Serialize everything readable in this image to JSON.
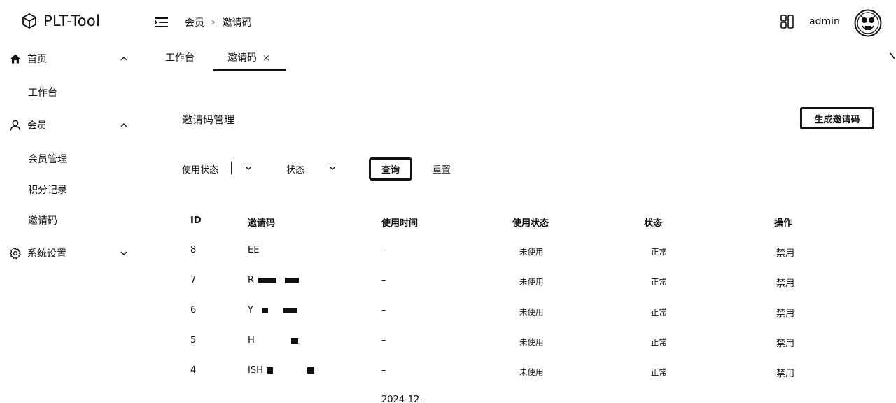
{
  "app": {
    "title": "PLT-Tool"
  },
  "sidebar": {
    "groups": [
      {
        "label": "首页",
        "icon": "home-icon",
        "expanded": true,
        "items": [
          {
            "label": "工作台"
          }
        ]
      },
      {
        "label": "会员",
        "icon": "user-icon",
        "expanded": true,
        "items": [
          {
            "label": "会员管理"
          },
          {
            "label": "积分记录"
          },
          {
            "label": "邀请码"
          }
        ]
      },
      {
        "label": "系统设置",
        "icon": "gear-icon",
        "expanded": false,
        "items": []
      }
    ]
  },
  "header": {
    "breadcrumb": [
      "会员",
      "邀请码"
    ],
    "user": "admin"
  },
  "tabs": [
    {
      "label": "工作台",
      "active": false
    },
    {
      "label": "邀请码",
      "active": true,
      "close": "×"
    }
  ],
  "page": {
    "title": "邀请码管理",
    "generate_button": "生成邀请码"
  },
  "filters": {
    "use_status_label": "使用状态",
    "status_label": "状态",
    "query_button": "查询",
    "reset_button": "重置"
  },
  "table": {
    "columns": [
      "ID",
      "邀请码",
      "使用时间",
      "使用状态",
      "状态",
      "操作"
    ],
    "rows": [
      {
        "id": "8",
        "code": "EE",
        "used_time": "–",
        "use_status": "未使用",
        "status": "正常",
        "action": "禁用"
      },
      {
        "id": "7",
        "code": "R",
        "used_time": "–",
        "use_status": "未使用",
        "status": "正常",
        "action": "禁用"
      },
      {
        "id": "6",
        "code": "Y",
        "used_time": "–",
        "use_status": "未使用",
        "status": "正常",
        "action": "禁用"
      },
      {
        "id": "5",
        "code": "H",
        "used_time": "–",
        "use_status": "未使用",
        "status": "正常",
        "action": "禁用"
      },
      {
        "id": "4",
        "code": "ISH",
        "used_time": "–",
        "use_status": "未使用",
        "status": "正常",
        "action": "禁用"
      }
    ],
    "partial_next_value": "2024-12-"
  }
}
